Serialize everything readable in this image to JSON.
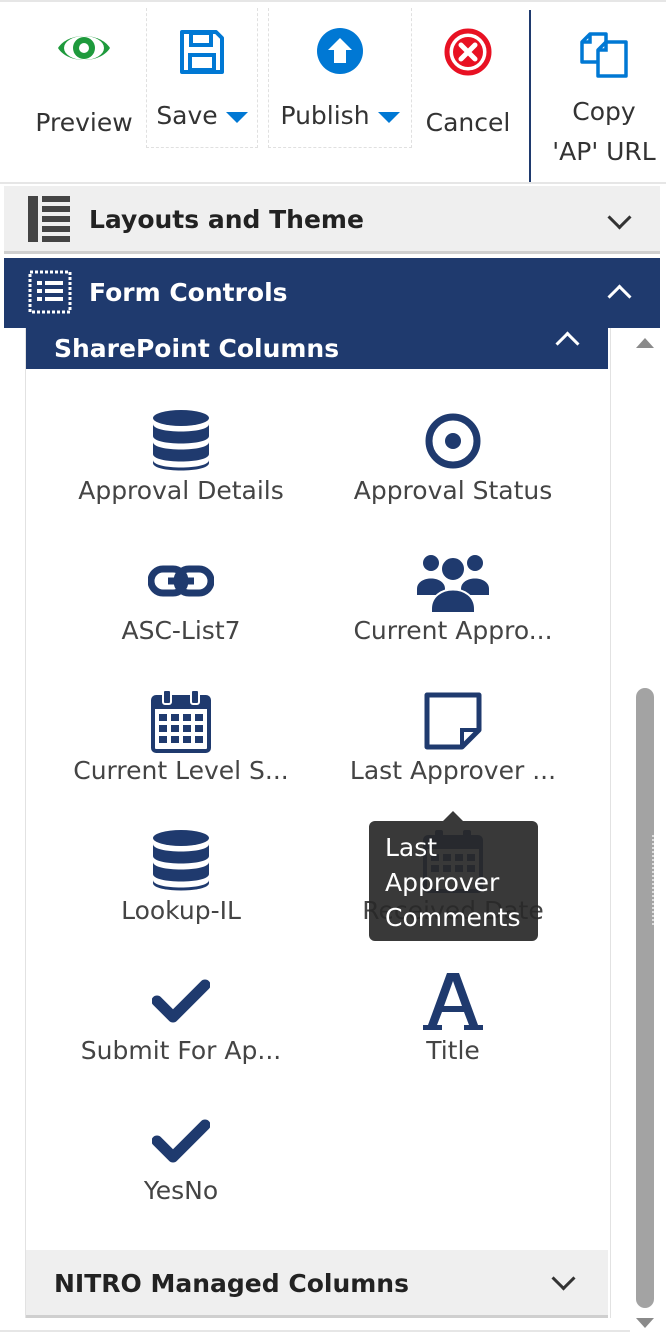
{
  "toolbar": {
    "preview_label": "Preview",
    "save_label": "Save",
    "publish_label": "Publish",
    "cancel_label": "Cancel",
    "copy_label_line1": "Copy",
    "copy_label_line2": "'AP' URL"
  },
  "accordions": {
    "layouts_title": "Layouts and Theme",
    "form_controls_title": "Form Controls",
    "sharepoint_columns_title": "SharePoint Columns",
    "nitro_columns_title": "NITRO Managed Columns"
  },
  "columns": [
    {
      "label": "Approval Details",
      "icon": "database-icon"
    },
    {
      "label": "Approval Status",
      "icon": "radio-icon"
    },
    {
      "label": "ASC-List7",
      "icon": "link-icon"
    },
    {
      "label": "Current Appro...",
      "icon": "users-icon"
    },
    {
      "label": "Current Level S...",
      "icon": "calendar-icon"
    },
    {
      "label": "Last Approver ...",
      "icon": "note-icon"
    },
    {
      "label": "Lookup-IL",
      "icon": "database-icon"
    },
    {
      "label": "Received Date",
      "icon": "calendar-icon"
    },
    {
      "label": "Submit For Ap...",
      "icon": "check-icon"
    },
    {
      "label": "Title",
      "icon": "text-icon"
    },
    {
      "label": "YesNo",
      "icon": "check-icon"
    }
  ],
  "tooltip": {
    "line1": "Last",
    "line2": "Approver",
    "line3": "Comments"
  },
  "colors": {
    "brand_navy": "#1f3a6e",
    "preview_green": "#1e9a3c",
    "publish_blue": "#0078d4",
    "cancel_red": "#e81123"
  }
}
